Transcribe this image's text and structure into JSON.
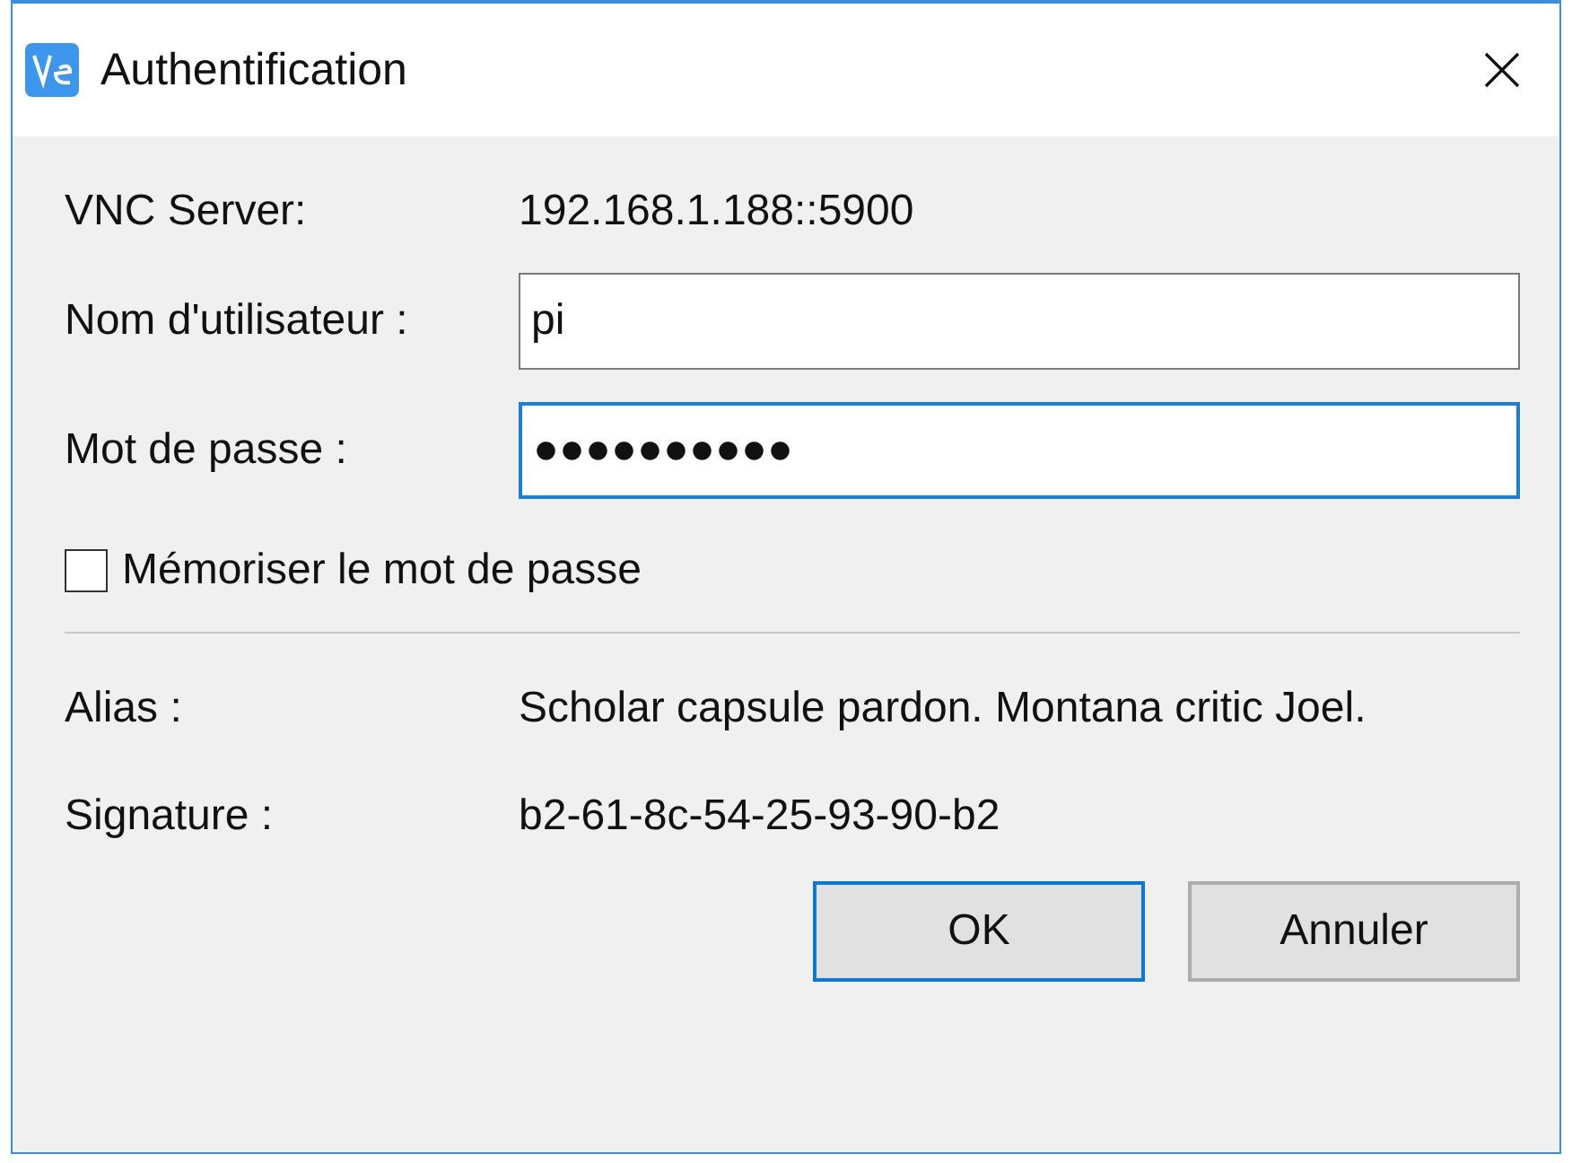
{
  "window": {
    "title": "Authentification"
  },
  "server": {
    "label": "VNC Server:",
    "value": "192.168.1.188::5900"
  },
  "fields": [
    {
      "label": "Nom d'utilisateur :",
      "value": "pi",
      "focused": false
    },
    {
      "label": "Mot de passe :",
      "value": "●●●●●●●●●●",
      "focused": true
    }
  ],
  "remember": {
    "label": "Mémoriser le mot de passe",
    "checked": false
  },
  "info": [
    {
      "label": "Alias :",
      "value": "Scholar capsule pardon. Montana critic Joel."
    },
    {
      "label": "Signature :",
      "value": "b2-61-8c-54-25-93-90-b2"
    }
  ],
  "buttons": [
    {
      "label": "OK",
      "default": true
    },
    {
      "label": "Annuler",
      "default": false
    }
  ]
}
